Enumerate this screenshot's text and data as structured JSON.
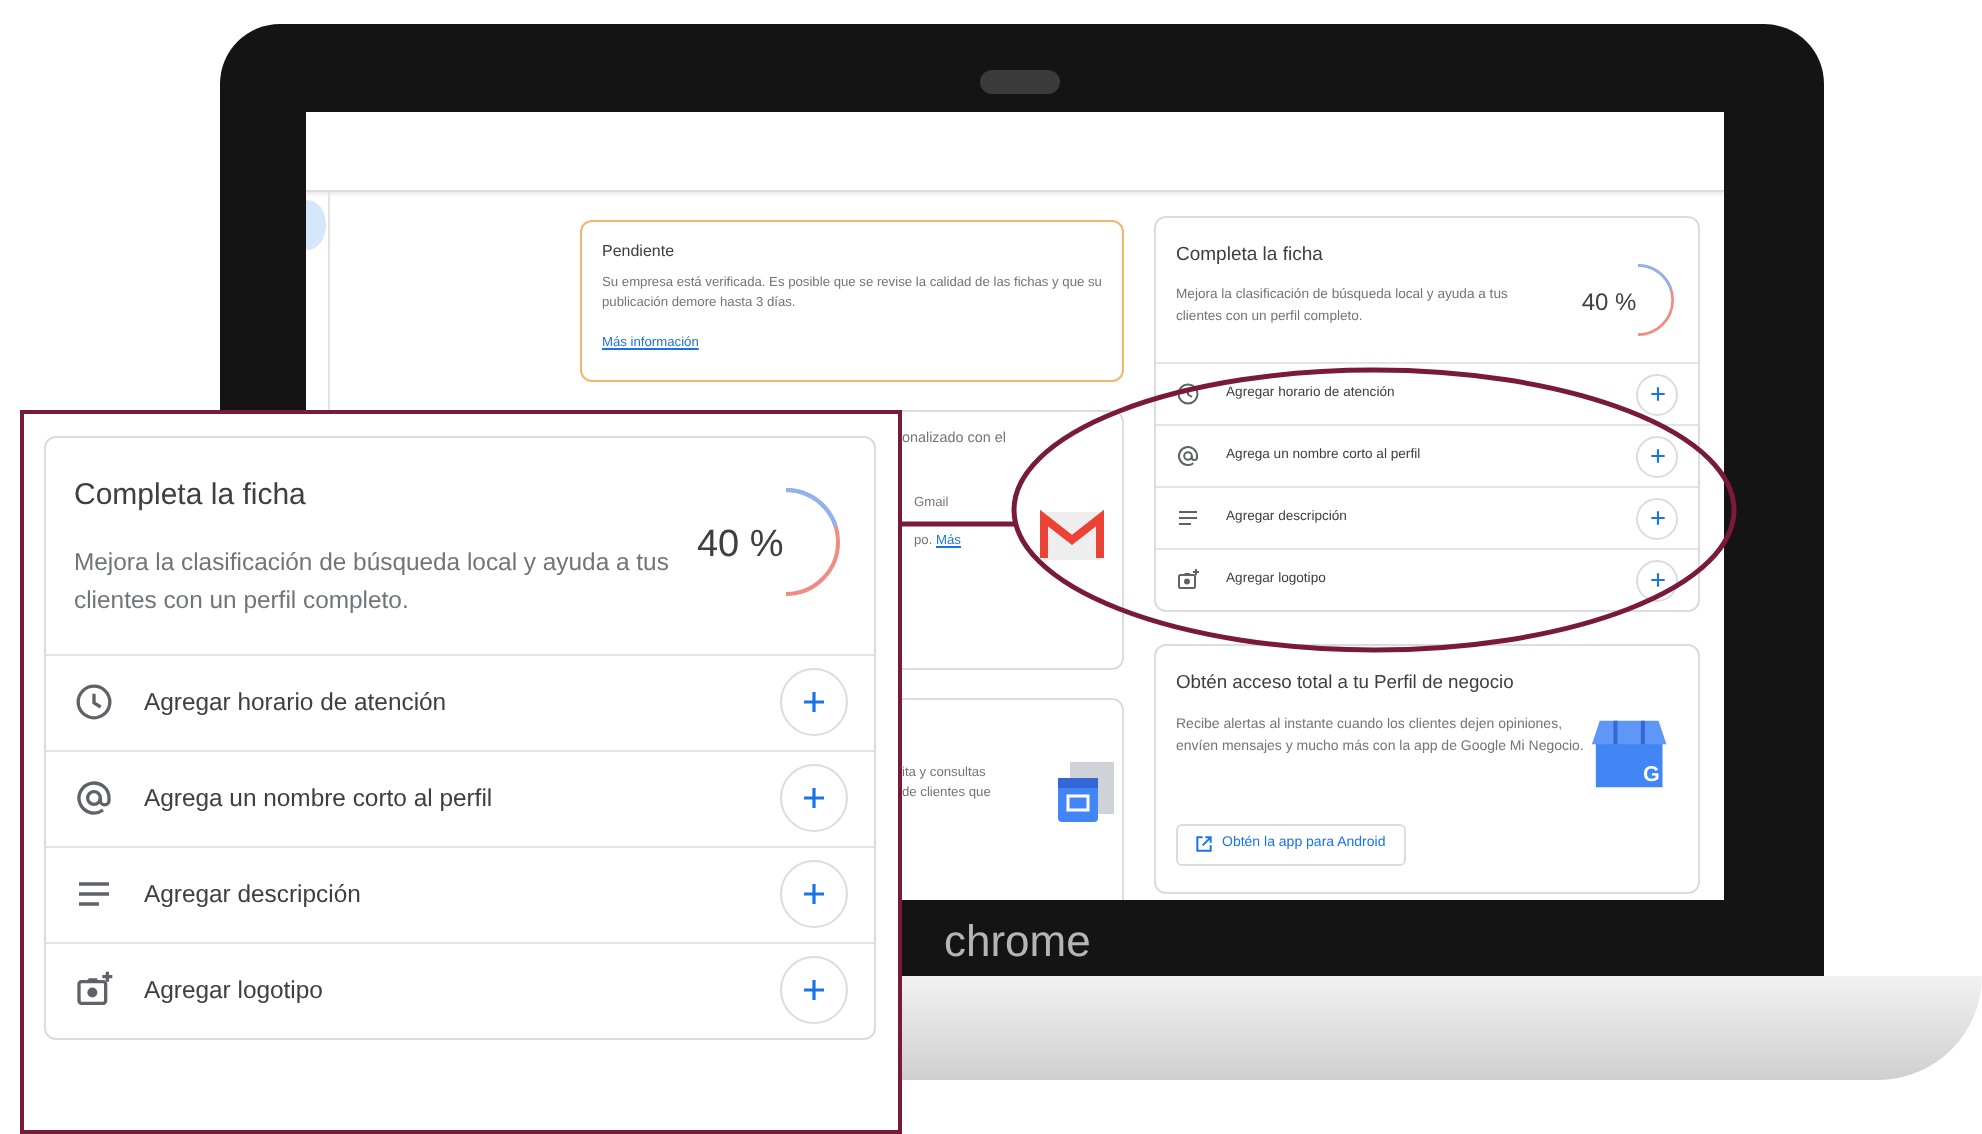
{
  "screen": {
    "pending_card": {
      "title": "Pendiente",
      "text": "Su empresa está verificada. Es posible que se revise la calidad de las fichas y que su publicación demore hasta 3 días.",
      "link": "Más información"
    },
    "partial_card_1": {
      "line_1": "onalizado con el",
      "line_2": "Gmail",
      "line_3": "po.",
      "link": "Más"
    },
    "partial_card_2": {
      "line_1": "ita y consultas",
      "line_2": "de clientes que"
    },
    "profile_card": {
      "title": "Completa la ficha",
      "description": "Mejora la clasificación de búsqueda local y ayuda a tus clientes con un perfil completo.",
      "progress": {
        "label": "40 %",
        "level": 0.4
      },
      "tasks": [
        {
          "kind": "clock",
          "label": "Agregar horario de atención"
        },
        {
          "kind": "at",
          "label": "Agrega un nombre corto al perfil"
        },
        {
          "kind": "lines",
          "label": "Agregar descripción"
        },
        {
          "kind": "photo",
          "label": "Agregar logotipo"
        }
      ]
    },
    "app_card": {
      "title": "Obtén acceso total a tu Perfil de negocio",
      "text": "Recibe alertas al instante cuando los clientes dejen opiniones, envíen mensajes y mucho más con la app de Google Mi Negocio.",
      "logo_letter": "G",
      "button": "Obtén la app para Android"
    }
  },
  "bezel_label": "chrome",
  "callout": {
    "title": "Completa la ficha",
    "description": "Mejora la clasificación de búsqueda local y ayuda a tus clientes con un perfil completo.",
    "progress": {
      "label": "40 %",
      "level": 0.4
    },
    "tasks": [
      {
        "kind": "clock",
        "label": "Agregar horario de atención"
      },
      {
        "kind": "at",
        "label": "Agrega un nombre corto al perfil"
      },
      {
        "kind": "lines",
        "label": "Agregar descripción"
      },
      {
        "kind": "photo",
        "label": "Agregar logotipo"
      }
    ]
  }
}
